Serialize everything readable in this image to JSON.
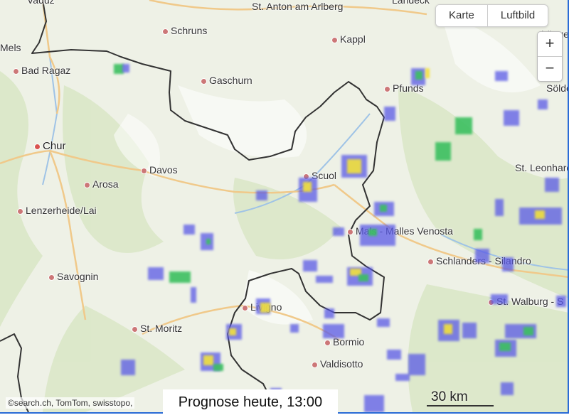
{
  "map_toggle": {
    "map_label": "Karte",
    "aerial_label": "Luftbild"
  },
  "zoom": {
    "in": "+",
    "out": "−"
  },
  "attribution": "©search.ch, TomTom, swisstopo,",
  "forecast_label": "Prognose heute, 13:00",
  "scale_label": "30 km",
  "places": [
    {
      "name": "Vaduz",
      "marker": false
    },
    {
      "name": "St. Anton am Arlberg",
      "marker": false
    },
    {
      "name": "Landeck",
      "marker": false
    },
    {
      "name": "Mels",
      "marker": false
    },
    {
      "name": "Schruns",
      "marker": true
    },
    {
      "name": "Kappl",
      "marker": true
    },
    {
      "name": "Bad Ragaz",
      "marker": true
    },
    {
      "name": "Gaschurn",
      "marker": true
    },
    {
      "name": "Pfunds",
      "marker": true
    },
    {
      "name": "Sölden",
      "marker": false
    },
    {
      "name": "Chur",
      "marker": true
    },
    {
      "name": "Davos",
      "marker": true
    },
    {
      "name": "Scuol",
      "marker": true
    },
    {
      "name": "Arosa",
      "marker": true
    },
    {
      "name": "St. Leonhard",
      "marker": false
    },
    {
      "name": "Lenzerheide/Lai",
      "marker": true
    },
    {
      "name": "Mals - Malles Venosta",
      "marker": true
    },
    {
      "name": "Schlanders - Silandro",
      "marker": true
    },
    {
      "name": "Savognin",
      "marker": true
    },
    {
      "name": "St. Walburg - S",
      "marker": true
    },
    {
      "name": "Livigno",
      "marker": true
    },
    {
      "name": "St. Moritz",
      "marker": true
    },
    {
      "name": "Bormio",
      "marker": true
    },
    {
      "name": "Valdisotto",
      "marker": true
    },
    {
      "name": "Längenfeld",
      "marker": false
    }
  ],
  "colors": {
    "border": "#333333",
    "rain_blue": "#5a5ae6",
    "rain_green": "#3cc060",
    "rain_yellow": "#f2e13c",
    "frame": "#2a6bd6"
  }
}
